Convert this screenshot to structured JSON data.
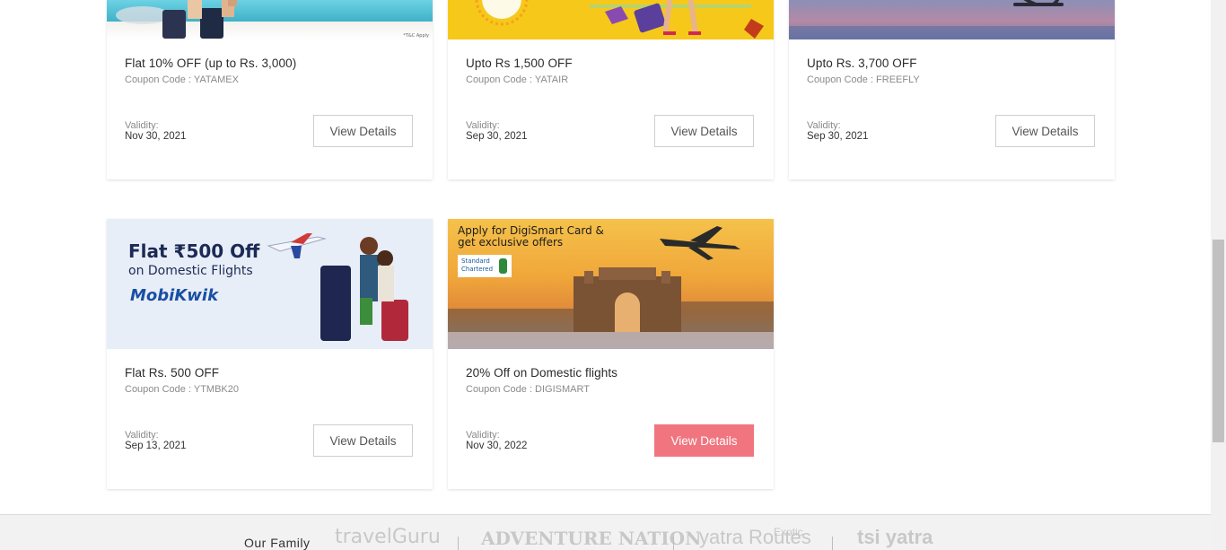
{
  "offers": [
    {
      "title": "Flat 10% OFF (up to Rs. 3,000)",
      "coupon": "Coupon Code : YATAMEX",
      "validity_label": "Validity:",
      "validity_date": "Nov 30, 2021",
      "button": "View Details",
      "banner_note": "*T&C Apply"
    },
    {
      "title": "Upto Rs 1,500 OFF",
      "coupon": "Coupon Code : YATAIR",
      "validity_label": "Validity:",
      "validity_date": "Sep 30, 2021",
      "button": "View Details"
    },
    {
      "title": "Upto Rs. 3,700 OFF",
      "coupon": "Coupon Code : FREEFLY",
      "validity_label": "Validity:",
      "validity_date": "Sep 30, 2021",
      "button": "View Details"
    },
    {
      "title": "Flat Rs. 500 OFF",
      "coupon": "Coupon Code : YTMBK20",
      "validity_label": "Validity:",
      "validity_date": "Sep 13, 2021",
      "button": "View Details",
      "banner_line1": "Flat ₹500 Off",
      "banner_line2": "on Domestic Flights",
      "banner_brand": "MobiKwik"
    },
    {
      "title": "20% Off on Domestic flights",
      "coupon": "Coupon Code : DIGISMART",
      "validity_label": "Validity:",
      "validity_date": "Nov 30, 2022",
      "button": "View Details",
      "banner_line1": "Apply for DigiSmart Card &",
      "banner_line2": "get exclusive offers",
      "banner_brand_line1": "Standard",
      "banner_brand_line2": "Chartered"
    }
  ],
  "footer": {
    "title": "Our Family",
    "brands": [
      "travelGuru",
      "ADVENTURE NATION",
      "yatra Routes",
      "Exotic",
      "tsi yatra"
    ]
  },
  "colors": {
    "accent": "#f0757f",
    "footer_bg": "#f2f2f2"
  },
  "icons": [
    "airplane-icon",
    "luggage-icon",
    "standard-chartered-logo-icon"
  ]
}
